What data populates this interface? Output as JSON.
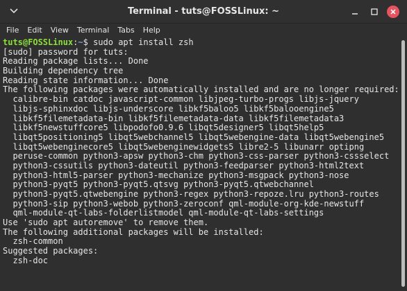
{
  "window": {
    "title": "Terminal - tuts@FOSSLinux: ~"
  },
  "menu": [
    "File",
    "Edit",
    "View",
    "Terminal",
    "Tabs",
    "Help"
  ],
  "prompt": {
    "user_host": "tuts@FOSSLinux",
    "separator": ":",
    "path": "~",
    "symbol": "$",
    "command": " sudo apt install zsh"
  },
  "output_lines": [
    "[sudo] password for tuts:",
    "Reading package lists... Done",
    "Building dependency tree",
    "Reading state information... Done",
    "The following packages were automatically installed and are no longer required:",
    "  calibre-bin catdoc javascript-common libjpeg-turbo-progs libjs-jquery",
    "  libjs-sphinxdoc libjs-underscore libkf5baloo5 libkf5balooengine5",
    "  libkf5filemetadata-bin libkf5filemetadata-data libkf5filemetadata3",
    "  libkf5newstuffcore5 libpodofo0.9.6 libqt5designer5 libqt5help5",
    "  libqt5positioning5 libqt5webchannel5 libqt5webengine-data libqt5webengine5",
    "  libqt5webenginecore5 libqt5webenginewidgets5 libre2-5 libunarr optipng",
    "  peruse-common python3-apsw python3-chm python3-css-parser python3-cssselect",
    "  python3-cssutils python3-dateutil python3-feedparser python3-html2text",
    "  python3-html5-parser python3-mechanize python3-msgpack python3-nose",
    "  python3-pyqt5 python3-pyqt5.qtsvg python3-pyqt5.qtwebchannel",
    "  python3-pyqt5.qtwebengine python3-regex python3-repoze.lru python3-routes",
    "  python3-sip python3-webob python3-zeroconf qml-module-org-kde-newstuff",
    "  qml-module-qt-labs-folderlistmodel qml-module-qt-labs-settings",
    "Use 'sudo apt autoremove' to remove them.",
    "The following additional packages will be installed:",
    "  zsh-common",
    "Suggested packages:",
    "  zsh-doc"
  ]
}
